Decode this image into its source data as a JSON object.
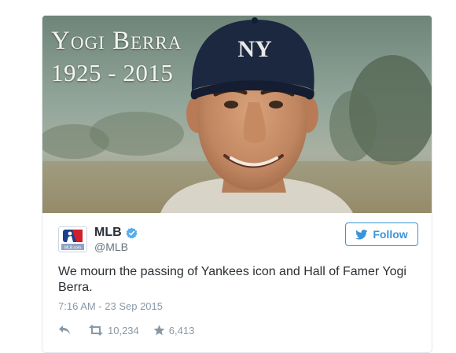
{
  "media": {
    "title": "Yogi Berra",
    "years": "1925 - 2015",
    "cap_logo": "NY"
  },
  "author": {
    "name": "MLB",
    "handle": "@MLB",
    "avatar_caption": "MLB.com",
    "verified_icon": "verified-badge-icon"
  },
  "follow_button": {
    "label": "Follow",
    "icon": "twitter-bird-icon"
  },
  "tweet": {
    "text": "We mourn the passing of Yankees icon and Hall of Famer Yogi Berra.",
    "timestamp": "7:16 AM - 23 Sep 2015"
  },
  "actions": {
    "reply_icon": "reply-icon",
    "retweet_icon": "retweet-icon",
    "retweet_count": "10,234",
    "like_icon": "star-icon",
    "like_count": "6,413"
  },
  "colors": {
    "accent": "#3b94d9",
    "text": "#292f33",
    "muted": "#8899a6",
    "verified": "#55acee"
  }
}
